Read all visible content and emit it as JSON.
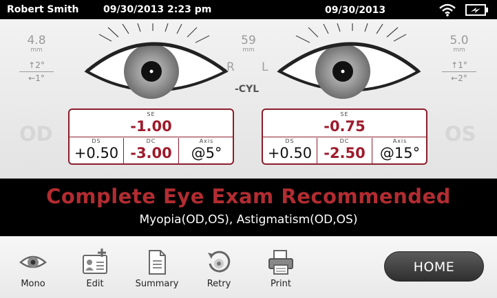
{
  "status": {
    "user": "Robert Smith",
    "datetime": "09/30/2013 2:23 pm",
    "date": "09/30/2013",
    "icons": [
      "wifi-icon",
      "battery-charging-icon"
    ]
  },
  "measurements": {
    "right_pupil": {
      "value": "4.8",
      "unit": "mm"
    },
    "right_tilt_up": "↑2°",
    "right_tilt_side": "←1°",
    "pd": {
      "value": "59",
      "unit": "mm"
    },
    "r_label": "R",
    "l_label": "L",
    "cyl_label": "-CYL",
    "left_pupil": {
      "value": "5.0",
      "unit": "mm"
    },
    "left_tilt_up": "↑1°",
    "left_tilt_side": "←2°",
    "od_label": "OD",
    "os_label": "OS"
  },
  "od": {
    "se_label": "SE",
    "se": "-1.00",
    "ds_label": "DS",
    "ds": "+0.50",
    "dc_label": "DC",
    "dc": "-3.00",
    "axis_label": "Axis",
    "axis": "@5°"
  },
  "os": {
    "se_label": "SE",
    "se": "-0.75",
    "ds_label": "DS",
    "ds": "+0.50",
    "dc_label": "DC",
    "dc": "-2.50",
    "axis_label": "Axis",
    "axis": "@15°"
  },
  "banner": {
    "title": "Complete Eye Exam Recommended",
    "subtitle": "Myopia(OD,OS), Astigmatism(OD,OS)"
  },
  "toolbar": {
    "mono": "Mono",
    "edit": "Edit",
    "summary": "Summary",
    "retry": "Retry",
    "print": "Print",
    "home": "HOME"
  },
  "colors": {
    "accent": "#9e1b2c",
    "banner_title": "#b22c31",
    "background": "#ececec"
  }
}
